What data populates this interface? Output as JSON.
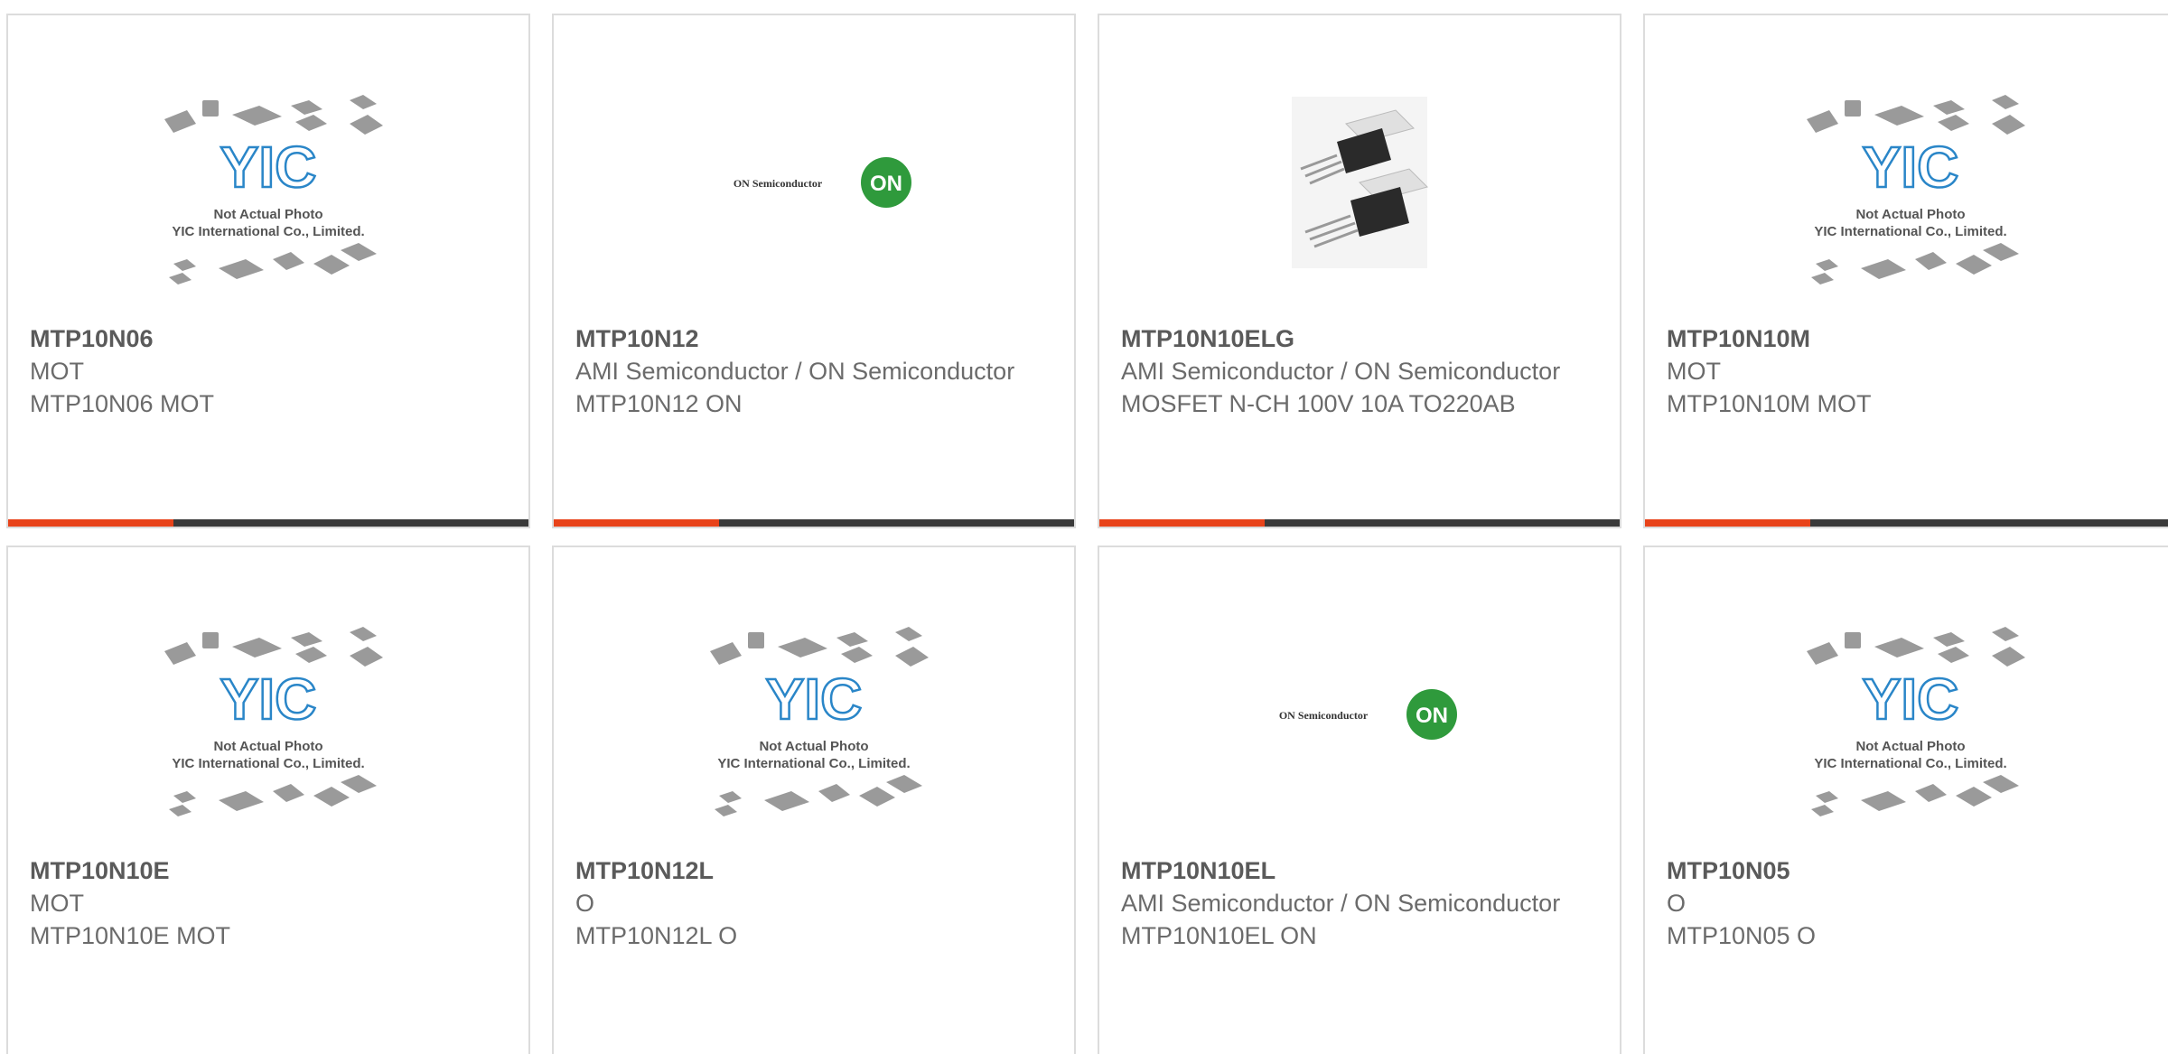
{
  "products": [
    {
      "part_number": "MTP10N06",
      "manufacturer": "MOT",
      "description": "MTP10N06 MOT",
      "image": "yic-placeholder",
      "image_text_line1": "Not Actual Photo",
      "image_text_line2": "YIC International Co., Limited.",
      "image_logo": "YIC"
    },
    {
      "part_number": "MTP10N12",
      "manufacturer": "AMI Semiconductor / ON Semiconductor",
      "description": "MTP10N12 ON",
      "image": "on-semi-logo",
      "image_text": "ON Semiconductor",
      "image_logo": "ON"
    },
    {
      "part_number": "MTP10N10ELG",
      "manufacturer": "AMI Semiconductor / ON Semiconductor",
      "description": "MOSFET N-CH 100V 10A TO220AB",
      "image": "to220-package-photo"
    },
    {
      "part_number": "MTP10N10M",
      "manufacturer": "MOT",
      "description": "MTP10N10M MOT",
      "image": "yic-placeholder",
      "image_text_line1": "Not Actual Photo",
      "image_text_line2": "YIC International Co., Limited.",
      "image_logo": "YIC"
    },
    {
      "part_number": "MTP10N10E",
      "manufacturer": "MOT",
      "description": "MTP10N10E MOT",
      "image": "yic-placeholder",
      "image_text_line1": "Not Actual Photo",
      "image_text_line2": "YIC International Co., Limited.",
      "image_logo": "YIC"
    },
    {
      "part_number": "MTP10N12L",
      "manufacturer": "O",
      "description": "MTP10N12L O",
      "image": "yic-placeholder",
      "image_text_line1": "Not Actual Photo",
      "image_text_line2": "YIC International Co., Limited.",
      "image_logo": "YIC"
    },
    {
      "part_number": "MTP10N10EL",
      "manufacturer": "AMI Semiconductor / ON Semiconductor",
      "description": "MTP10N10EL ON",
      "image": "on-semi-logo",
      "image_text": "ON Semiconductor",
      "image_logo": "ON"
    },
    {
      "part_number": "MTP10N05",
      "manufacturer": "O",
      "description": "MTP10N05 O",
      "image": "yic-placeholder",
      "image_text_line1": "Not Actual Photo",
      "image_text_line2": "YIC International Co., Limited.",
      "image_logo": "YIC"
    }
  ],
  "colors": {
    "accent": "#e8431a",
    "bar": "#3a3a3a",
    "yic_blue": "#2a86c8",
    "on_green": "#2f9a3c"
  }
}
